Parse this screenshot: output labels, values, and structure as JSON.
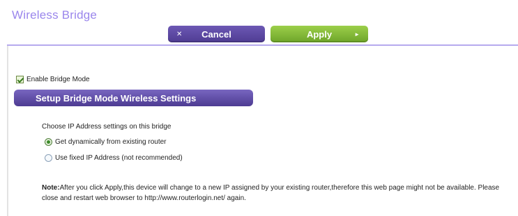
{
  "header": {
    "title": "Wireless Bridge",
    "cancel_label": "Cancel",
    "cancel_glyph": "✕",
    "apply_label": "Apply",
    "apply_glyph": "►"
  },
  "bridge": {
    "enable_label": "Enable Bridge Mode",
    "enable_checked": true,
    "section_title": "Setup Bridge Mode Wireless Settings"
  },
  "ip_settings": {
    "prompt": "Choose IP Address settings on this bridge",
    "options": [
      {
        "label": "Get dynamically from existing router",
        "selected": true
      },
      {
        "label": "Use fixed IP Address (not recommended)",
        "selected": false
      }
    ]
  },
  "note": {
    "prefix": "Note:",
    "text": "After you click Apply,this device will change to a new IP assigned by your existing router,therefore this web page might not be available. Please close and restart web browser to http://www.routerlogin.net/ again."
  },
  "colors": {
    "title": "#9a86ec",
    "purple_button": "#5a46a4",
    "green_button": "#86bb3a",
    "rule": "#b6a9ee"
  }
}
